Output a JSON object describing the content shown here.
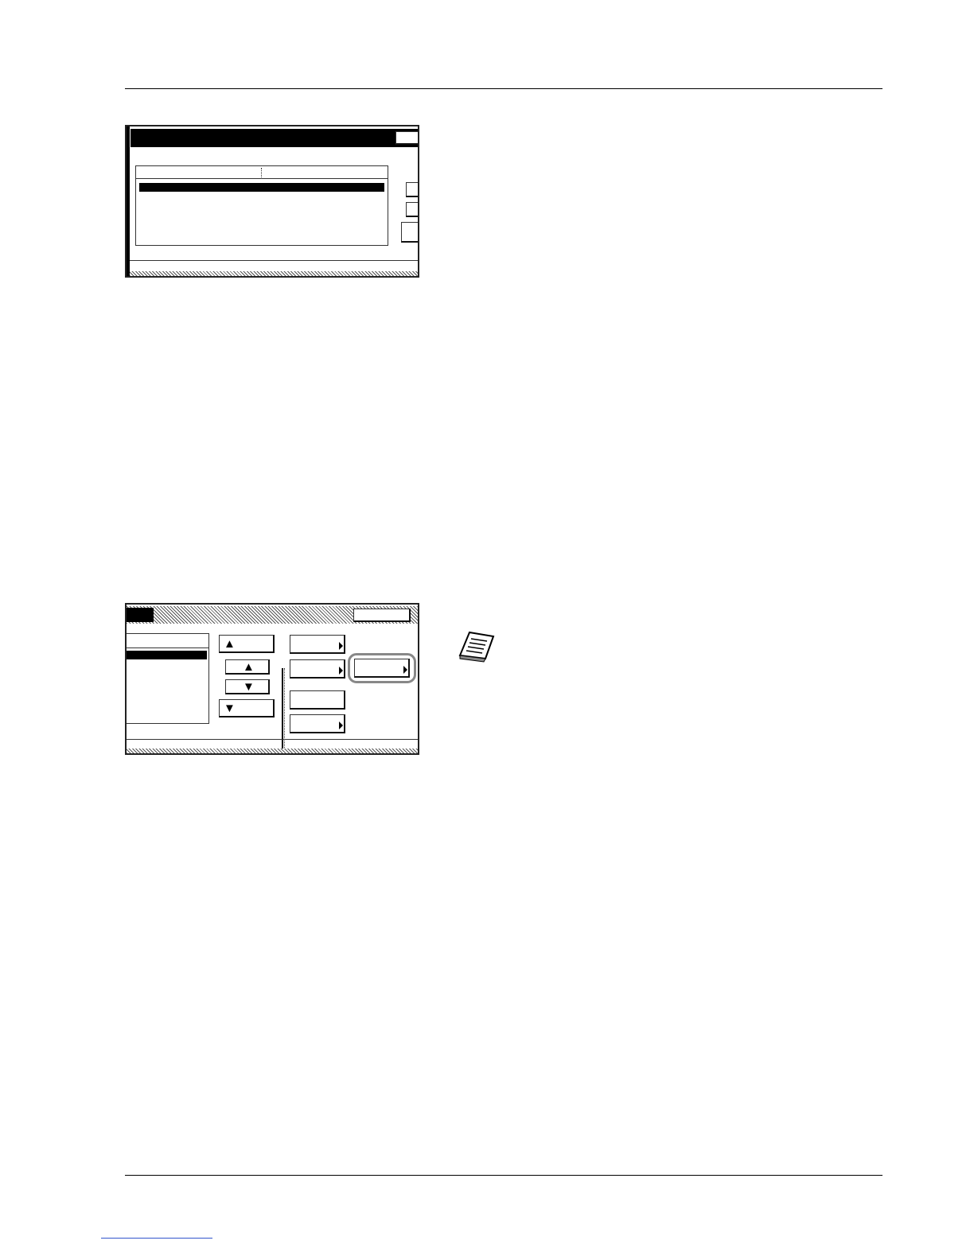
{
  "page": {
    "figure1": {
      "panel": "job-list-screen",
      "title_bar": "",
      "top_right_button": "",
      "list_columns": [
        "",
        ""
      ],
      "selected_row": ""
    },
    "figure2": {
      "panel": "job-detail-screen",
      "title_bar": "",
      "top_right_button": "",
      "buttons": {
        "scroll_top": "▲",
        "scroll_up": "▲",
        "scroll_down": "▼",
        "scroll_bottom": "▼"
      },
      "highlighted_button": ""
    },
    "note_icon": "note-paper-icon",
    "link_text": ""
  }
}
